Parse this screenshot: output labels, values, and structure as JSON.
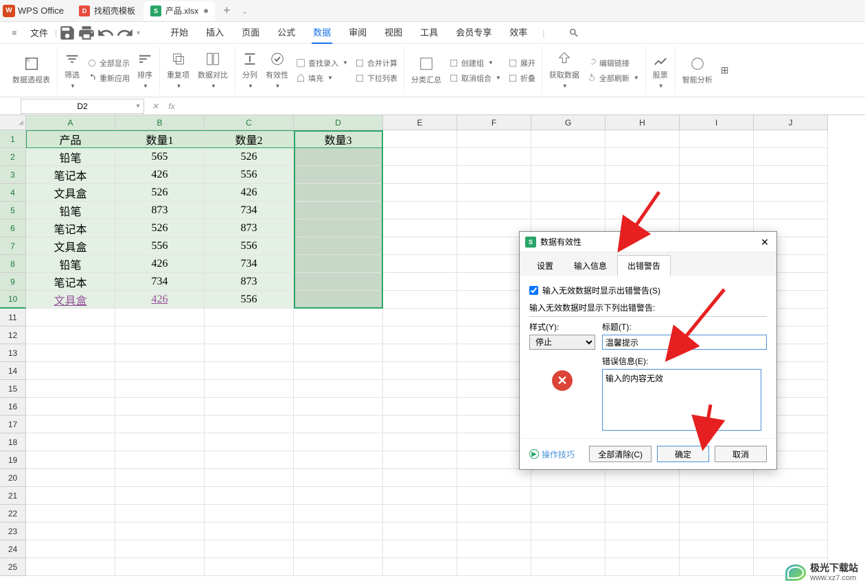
{
  "app": {
    "name": "WPS Office"
  },
  "title_tabs": [
    {
      "iconClass": "red",
      "iconText": "D",
      "text": "找稻壳模板",
      "active": false
    },
    {
      "iconClass": "green",
      "iconText": "S",
      "text": "产品.xlsx",
      "active": true,
      "dot": true
    }
  ],
  "menu": {
    "file": "文件",
    "items": [
      "开始",
      "插入",
      "页面",
      "公式",
      "数据",
      "审阅",
      "视图",
      "工具",
      "会员专享",
      "效率"
    ],
    "active": "数据"
  },
  "ribbon": {
    "pivot": "数据透视表",
    "filter": "筛选",
    "showAll": "全部显示",
    "reapply": "重新应用",
    "sort": "排序",
    "dup": "重复项",
    "dataCompare": "数据对比",
    "splitCol": "分列",
    "validity": "有效性",
    "lookup": "查找录入",
    "fill": "填充",
    "merge": "合并计算",
    "toCol": "下拉列表",
    "subtotal": "分类汇总",
    "group": "创建组",
    "ungroup": "取消组合",
    "expand": "展开",
    "collapse": "折叠",
    "getData": "获取数据",
    "editLink": "编辑链接",
    "refreshAll": "全部刷新",
    "stock": "股票",
    "smartAnalysis": "智能分析"
  },
  "nameBox": "D2",
  "columns": [
    "A",
    "B",
    "C",
    "D",
    "E",
    "F",
    "G",
    "H",
    "I",
    "J"
  ],
  "rows": [
    "1",
    "2",
    "3",
    "4",
    "5",
    "6",
    "7",
    "8",
    "9",
    "10",
    "11",
    "12",
    "13",
    "14",
    "15",
    "16",
    "17",
    "18",
    "19",
    "20",
    "21",
    "22",
    "23",
    "24",
    "25"
  ],
  "table": {
    "headers": [
      "产品",
      "数量1",
      "数量2",
      "数量3"
    ],
    "data": [
      [
        "铅笔",
        "565",
        "526"
      ],
      [
        "笔记本",
        "426",
        "556"
      ],
      [
        "文具盒",
        "526",
        "426"
      ],
      [
        "铅笔",
        "873",
        "734"
      ],
      [
        "笔记本",
        "526",
        "873"
      ],
      [
        "文具盒",
        "556",
        "556"
      ],
      [
        "铅笔",
        "426",
        "734"
      ],
      [
        "笔记本",
        "734",
        "873"
      ],
      [
        "文具盒",
        "426",
        "556"
      ]
    ]
  },
  "dialog": {
    "title": "数据有效性",
    "tabs": [
      "设置",
      "输入信息",
      "出错警告"
    ],
    "activeTab": "出错警告",
    "checkbox": "输入无效数据时显示出错警告(S)",
    "sectionLabel": "输入无效数据时显示下列出错警告:",
    "styleLabel": "样式(Y):",
    "styleValue": "停止",
    "titleLabel": "标题(T):",
    "titleValue": "温馨提示",
    "errLabel": "错误信息(E):",
    "errValue": "输入的内容无效",
    "tips": "操作技巧",
    "clear": "全部清除(C)",
    "ok": "确定",
    "cancel": "取消"
  },
  "watermark": {
    "brand": "极光下载站",
    "url": "www.xz7.com"
  }
}
